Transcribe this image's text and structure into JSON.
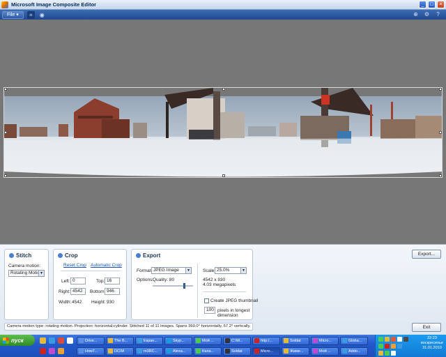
{
  "window": {
    "title": "Microsoft Image Composite Editor",
    "controls": [
      "_",
      "□",
      "×"
    ]
  },
  "toolbar": {
    "file_label": "File"
  },
  "stitch": {
    "title": "Stitch",
    "camera_motion_label": "Camera motion:",
    "camera_motion_value": "Rotating Motion"
  },
  "crop": {
    "title": "Crop",
    "reset_link": "Reset Crop",
    "auto_link": "Automatic Crop",
    "left_label": "Left:",
    "left_value": "0",
    "top_label": "Top:",
    "top_value": "16",
    "right_label": "Right:",
    "right_value": "4542",
    "bottom_label": "Bottom:",
    "bottom_value": "946",
    "width_label": "Width:",
    "width_value": "4542",
    "height_label": "Height:",
    "height_value": "930"
  },
  "export": {
    "title": "Export",
    "format_label": "Format:",
    "format_value": "JPEG Image",
    "options_label": "Options:",
    "quality_label": "Quality: 80",
    "quality_level": 80,
    "scale_label": "Scale:",
    "scale_value": "25.0%",
    "dimensions": "4542 x 930",
    "megapixels": "4.03 megapixels",
    "thumbnail_label": "Create JPEG thumbnail",
    "thumb_size": "100",
    "thumb_desc_1": "pixels in longest",
    "thumb_desc_2": "dimension",
    "export_button": "Export..."
  },
  "status": {
    "text": "Camera motion type: rotating motion. Projection: horizontal-cylinder. Stitched 11 of 11 images. Spans 360.0° horizontally, 67.2° vertically."
  },
  "exit_button": "Exit",
  "taskbar": {
    "start_label": "пуск",
    "row1": [
      "Drive...",
      "The B...",
      "Екран...",
      "Skyp...",
      "Мой ...",
      "C:\\W...",
      "http:/...",
      "Soldat",
      "Micro...",
      "Globa..."
    ],
    "row2": [
      "HowT...",
      "DCIM",
      "m3RC...",
      "Alexa...",
      "Кала...",
      "Soldat",
      "Micro...",
      "Жиме...",
      "Мой ...",
      "Addo..."
    ],
    "clock_time": "22:23",
    "clock_day": "воскресенье",
    "clock_date": "31.01.2010"
  },
  "colors": {
    "accent": "#2459cc",
    "start_green": "#2e8a24",
    "canvas": "#777777"
  }
}
